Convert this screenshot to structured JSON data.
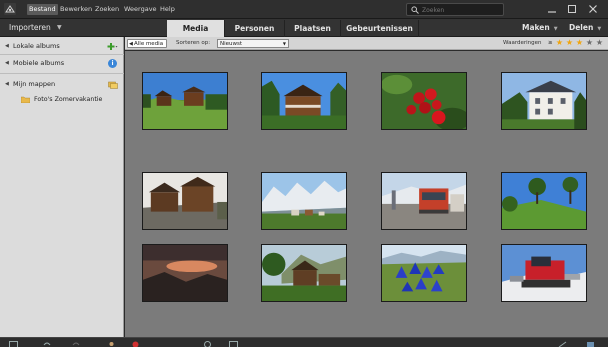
{
  "menubar": {
    "items": [
      "Bestand",
      "Bewerken",
      "Zoeken",
      "Weergave",
      "Help"
    ],
    "search_placeholder": "Zoeken"
  },
  "toolbar": {
    "import_label": "Importeren",
    "tabs": [
      "Media",
      "Personen",
      "Plaatsen",
      "Gebeurtenissen"
    ],
    "active_tab": "Media",
    "create_label": "Maken",
    "share_label": "Delen"
  },
  "sidebar": {
    "local_albums": "Lokale albums",
    "mobile_albums": "Mobiele albums",
    "my_folders": "Mijn mappen",
    "folder_item": "Foto's Zomervakantie"
  },
  "grid_header": {
    "all_media": "Alle media",
    "sort_label": "Sorteren op:",
    "sort_value": "Nieuwst",
    "ratings_label": "Waarderingen",
    "ratings_operator": "≥",
    "rating_filled": 3,
    "rating_total": 5
  },
  "thumbnails": [
    "alpine-chalets-meadow",
    "wooden-chalet-blue-sky",
    "red-cherries",
    "white-villa",
    "chalets-on-hillside",
    "snowy-mountain-village",
    "red-mountain-train",
    "trees-on-green-hill",
    "sunset-mountains",
    "chalet-in-forest",
    "blue-gentian-flowers",
    "red-snow-groomer"
  ],
  "colors": {
    "accent_star": "#f0a40c",
    "grid_bg": "#7b7b7b",
    "panel_bg": "#dcdcdc"
  }
}
